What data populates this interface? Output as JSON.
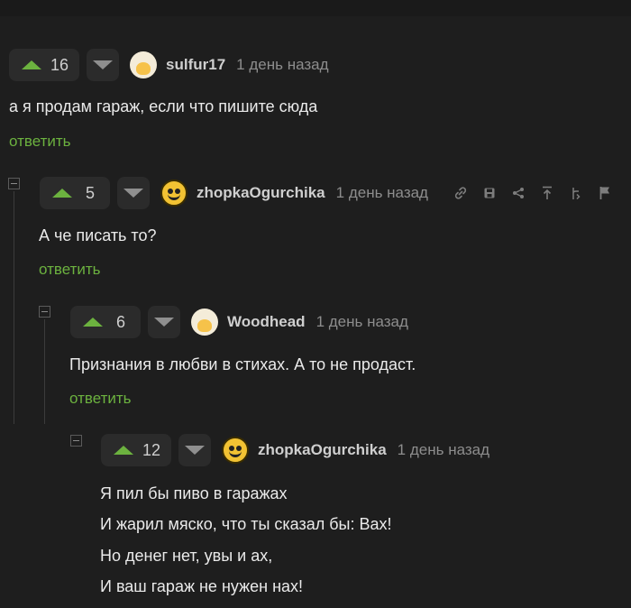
{
  "comments": [
    {
      "votes": "16",
      "author": "sulfur17",
      "time": "1 день назад",
      "lines": [
        "а я продам гараж, если что пишите сюда"
      ],
      "reply": "ответить"
    },
    {
      "votes": "5",
      "author": "zhopkaOgurchika",
      "time": "1 день назад",
      "lines": [
        "А че писать то?"
      ],
      "reply": "ответить",
      "tools": [
        "link-icon",
        "save-icon",
        "share-icon",
        "go-to-parent-icon",
        "branch-icon",
        "report-flag-icon"
      ]
    },
    {
      "votes": "6",
      "author": "Woodhead",
      "time": "1 день назад",
      "lines": [
        "Признания в любви в стихах. А то не продаст."
      ],
      "reply": "ответить"
    },
    {
      "votes": "12",
      "author": "zhopkaOgurchika",
      "time": "1 день назад",
      "lines": [
        "Я пил бы пиво в гаражах",
        "И жарил мяско, что ты сказал бы: Вах!",
        "Но денег нет, увы и ах,",
        "И ваш гараж не нужен нах!"
      ]
    }
  ],
  "colors": {
    "upvote": "#6cb23f",
    "reply": "#6cb23f",
    "background": "#1e1e1e"
  }
}
